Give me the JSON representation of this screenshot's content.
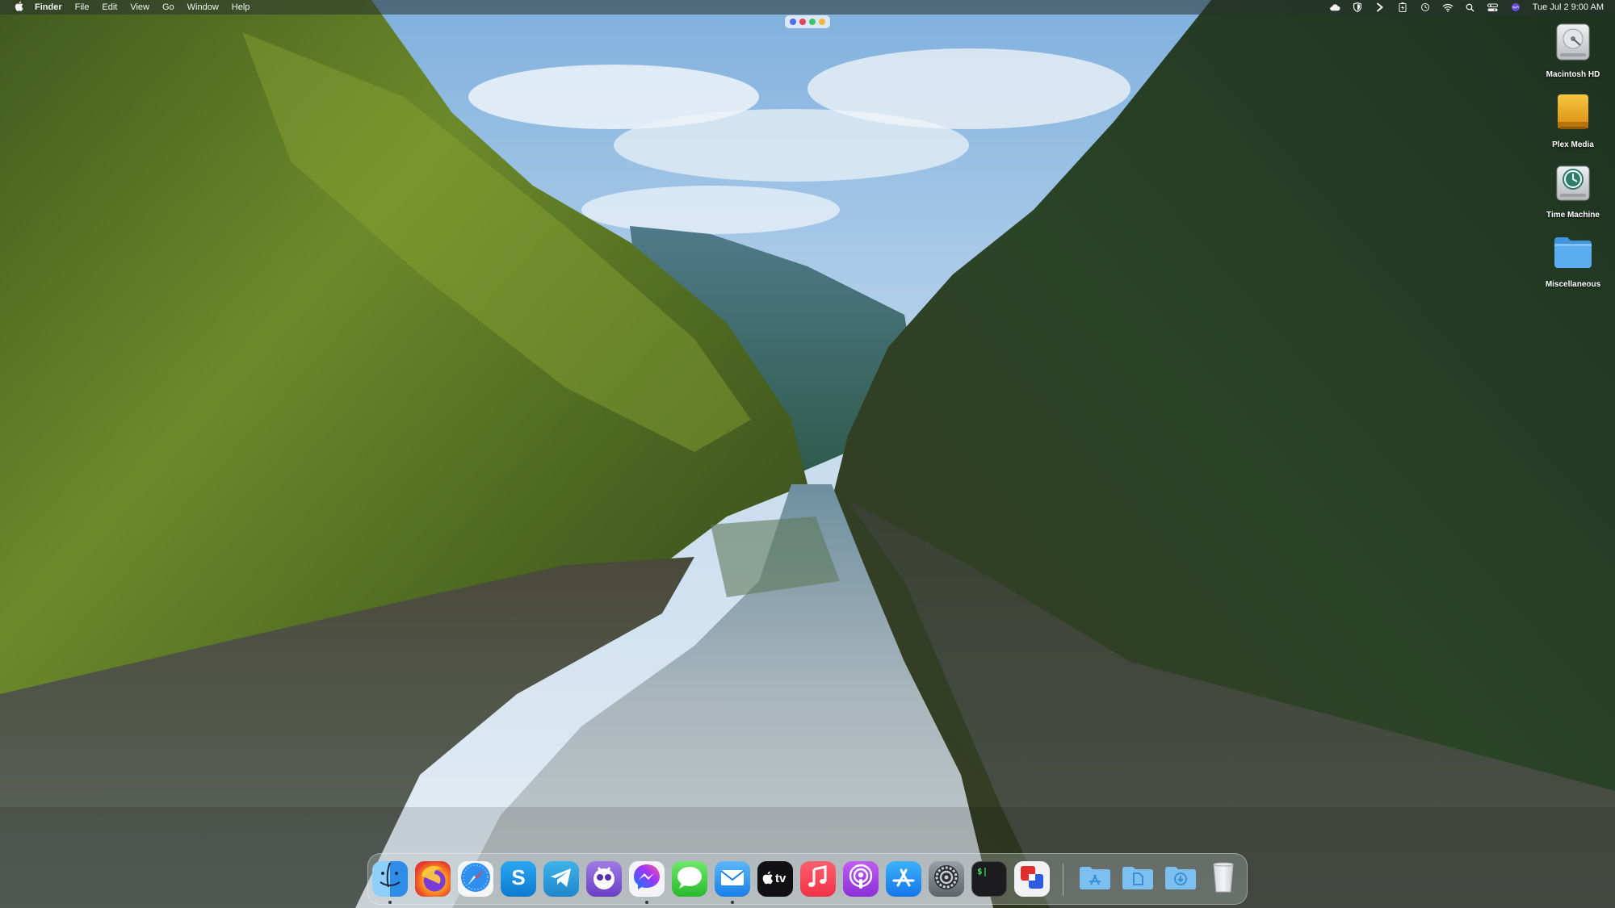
{
  "menubar": {
    "app_name": "Finder",
    "items": [
      "File",
      "Edit",
      "View",
      "Go",
      "Window",
      "Help"
    ],
    "status_icons": [
      "cloud-icon",
      "shield-icon",
      "chevron-right-icon",
      "battery-icon",
      "time-machine-icon",
      "wifi-icon",
      "spotlight-search-icon",
      "control-center-icon",
      "siri-icon"
    ],
    "clock": "Tue Jul 2  9:00 AM"
  },
  "stage_dots": {
    "colors": [
      "#4f6df0",
      "#e0455a",
      "#3cc468",
      "#f0b840"
    ]
  },
  "desktop_icons": [
    {
      "label": "Macintosh HD",
      "icon": "hard-drive-icon"
    },
    {
      "label": "Plex Media",
      "icon": "external-drive-icon"
    },
    {
      "label": "Time Machine",
      "icon": "time-machine-drive-icon"
    },
    {
      "label": "Miscellaneous",
      "icon": "folder-icon"
    }
  ],
  "dock": {
    "apps": [
      {
        "name": "finder",
        "icon": "finder-icon",
        "running": true
      },
      {
        "name": "firefox",
        "icon": "firefox-icon",
        "running": false
      },
      {
        "name": "safari",
        "icon": "safari-icon",
        "running": false
      },
      {
        "name": "skype",
        "icon": "skype-icon",
        "running": false
      },
      {
        "name": "telegram",
        "icon": "telegram-icon",
        "running": false
      },
      {
        "name": "tweetbot",
        "icon": "tweetbot-icon",
        "running": false
      },
      {
        "name": "messenger",
        "icon": "messenger-icon",
        "running": true
      },
      {
        "name": "messages",
        "icon": "messages-icon",
        "running": false
      },
      {
        "name": "mail",
        "icon": "mail-icon",
        "running": true
      },
      {
        "name": "apple-tv",
        "icon": "apple-tv-icon",
        "running": false
      },
      {
        "name": "music",
        "icon": "music-icon",
        "running": false
      },
      {
        "name": "podcasts",
        "icon": "podcasts-icon",
        "running": false
      },
      {
        "name": "app-store",
        "icon": "app-store-icon",
        "running": false
      },
      {
        "name": "system-settings",
        "icon": "gear-icon",
        "running": false
      },
      {
        "name": "terminal",
        "icon": "terminal-icon",
        "running": false
      },
      {
        "name": "parallels",
        "icon": "parallels-icon",
        "running": false
      }
    ],
    "stacks": [
      {
        "name": "applications-folder",
        "icon": "applications-folder-icon"
      },
      {
        "name": "documents-folder",
        "icon": "documents-folder-icon"
      },
      {
        "name": "downloads-folder",
        "icon": "downloads-folder-icon"
      },
      {
        "name": "trash",
        "icon": "trash-icon"
      }
    ],
    "tv_text": "tv",
    "terminal_text": "$|"
  },
  "colors": {
    "menubar_bg": "#28322d",
    "folder_blue": "#5aaef0"
  }
}
